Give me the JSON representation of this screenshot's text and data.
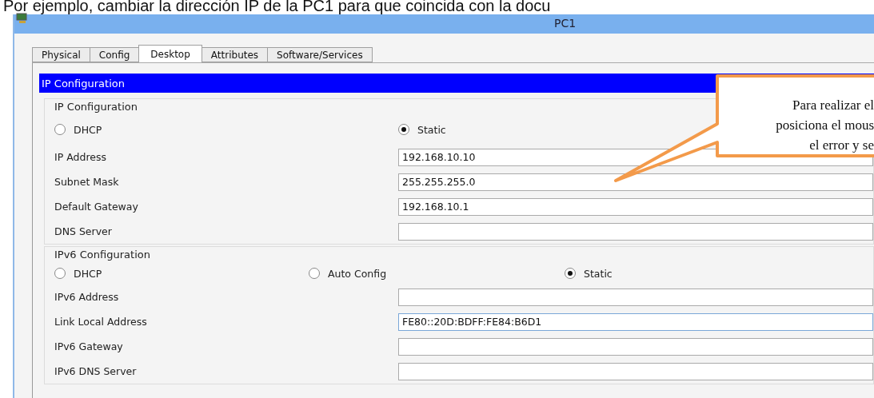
{
  "caption": "Por ejemplo, cambiar la dirección IP de la PC1 para que coincida con la docu",
  "window": {
    "title": "PC1"
  },
  "tabs": [
    {
      "label": "Physical",
      "selected": false
    },
    {
      "label": "Config",
      "selected": false
    },
    {
      "label": "Desktop",
      "selected": true
    },
    {
      "label": "Attributes",
      "selected": false
    },
    {
      "label": "Software/Services",
      "selected": false
    }
  ],
  "header": "IP Configuration",
  "groups": [
    {
      "title": "IP Configuration",
      "options": [
        {
          "label": "DHCP",
          "selected": false
        },
        {
          "label": "Static",
          "selected": true
        }
      ],
      "fields": [
        {
          "label": "IP Address",
          "value": "192.168.10.10"
        },
        {
          "label": "Subnet Mask",
          "value": "255.255.255.0"
        },
        {
          "label": "Default Gateway",
          "value": "192.168.10.1"
        },
        {
          "label": "DNS Server",
          "focused": false
        }
      ]
    },
    {
      "title": "IPv6 Configuration",
      "options": [
        {
          "label": "DHCP",
          "selected": false
        },
        {
          "label": "Auto Config",
          "selected": false
        },
        {
          "label": "Static",
          "selected": true
        }
      ],
      "fields": [
        {
          "label": "IPv6 Address",
          "focused": false
        },
        {
          "label": "Link Local Address",
          "value": "FE80::20D:BDFF:FE84:B6D1",
          "focused": true
        },
        {
          "label": "IPv6 Gateway",
          "focused": false
        },
        {
          "label": "IPv6 DNS Server",
          "focused": false
        }
      ]
    }
  ],
  "callout": {
    "lines": [
      "Para realizar el",
      "posiciona el mous",
      "el error y se"
    ]
  }
}
